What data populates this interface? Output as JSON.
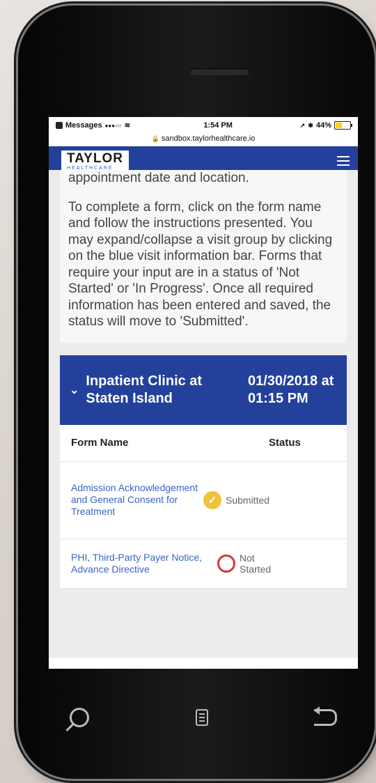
{
  "status_bar": {
    "carrier": "Messages",
    "signal": "●●●○○",
    "wifi": "wifi-icon",
    "time": "1:54 PM",
    "battery": "44%"
  },
  "browser": {
    "url": "sandbox.taylorhealthcare.io"
  },
  "navbar": {
    "logo_name": "TAYLOR",
    "logo_sub": "HEALTHCARE",
    "menu_icon": "hamburger-icon",
    "brand_color": "#23409b"
  },
  "intro": {
    "partial_line": "appointment date and location.",
    "paragraph": "To complete a form, click on the form name and follow the instructions presented. You may expand/collapse a visit group by clicking on the blue visit information bar. Forms that require your input are in a status of 'Not Started' or 'In Progress'. Once all required information has been entered and saved, the status will move to 'Submitted'."
  },
  "visit": {
    "location": "Inpatient Clinic at Staten Island",
    "datetime": "01/30/2018 at 01:15 PM",
    "expand_icon": "chevron-down-icon"
  },
  "table": {
    "headers": [
      "Form Name",
      "Status"
    ],
    "rows": [
      {
        "form_name": "Admission Acknowledgement and General Consent for Treatment",
        "status": "Submitted",
        "status_icon": "check-circle-icon",
        "status_color": "#f0c23a"
      },
      {
        "form_name": "PHI, Third-Party Payer Notice, Advance Directive",
        "status": "Not Started",
        "status_icon": "empty-circle-icon",
        "status_color": "#d43a32"
      }
    ]
  }
}
